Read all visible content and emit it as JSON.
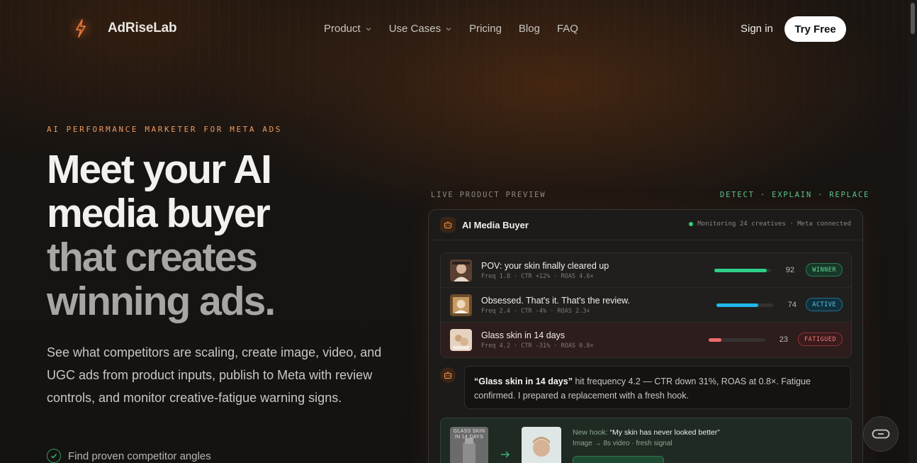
{
  "nav": {
    "brand": "AdRiseLab",
    "links": [
      {
        "label": "Product",
        "dropdown": true
      },
      {
        "label": "Use Cases",
        "dropdown": true
      },
      {
        "label": "Pricing",
        "dropdown": false
      },
      {
        "label": "Blog",
        "dropdown": false
      },
      {
        "label": "FAQ",
        "dropdown": false
      }
    ],
    "sign_in": "Sign in",
    "cta": "Try Free"
  },
  "hero": {
    "eyebrow": "AI PERFORMANCE MARKETER FOR META ADS",
    "headline_line1": "Meet your AI",
    "headline_line2": "media buyer",
    "headline_line3": "that creates",
    "headline_line4": "winning ads.",
    "lead": "See what competitors are scaling, create image, video, and UGC ads from product inputs, publish to Meta with review controls, and monitor creative-fatigue warning signs.",
    "checklist": [
      "Find proven competitor angles"
    ]
  },
  "preview": {
    "label": "LIVE PRODUCT PREVIEW",
    "steps": "DETECT · EXPLAIN · REPLACE",
    "panel_title": "AI Media Buyer",
    "status": "Monitoring 24 creatives · Meta connected",
    "rows": [
      {
        "title": "POV: your skin finally cleared up",
        "meta": "Freq 1.8 · CTR +12% · ROAS 4.6×",
        "score": "92",
        "level": 0.92,
        "badge": "WINNER",
        "bar_color": "#2ecf86"
      },
      {
        "title": "Obsessed. That's it. That's the review.",
        "meta": "Freq 2.4 · CTR -4% · ROAS 2.3×",
        "score": "74",
        "level": 0.74,
        "badge": "ACTIVE",
        "bar_color": "#22b6ea"
      },
      {
        "title": "Glass skin in 14 days",
        "meta": "Freq 4.2 · CTR -31% · ROAS 0.8×",
        "score": "23",
        "level": 0.23,
        "badge": "FATIGUED",
        "bar_color": "#f06a6a"
      }
    ],
    "message": {
      "quote": "“Glass skin in 14 days”",
      "text": " hit frequency 4.2 — CTR down 31%, ROAS at 0.8×. Fatigue confirmed. I prepared a replacement with a fresh hook."
    },
    "hook": {
      "old_thumb_text": "GLASS SKIN IN 14 DAYS",
      "label": "New hook: ",
      "quote": "“My skin has never looked better”",
      "sub": "Image → 8s video · fresh signal"
    }
  },
  "colors": {
    "accent_orange": "#ee9a5f",
    "accent_green": "#5cc58c",
    "winner": "#2ecf86",
    "active": "#22b6ea",
    "fatigued": "#f06a6a"
  }
}
